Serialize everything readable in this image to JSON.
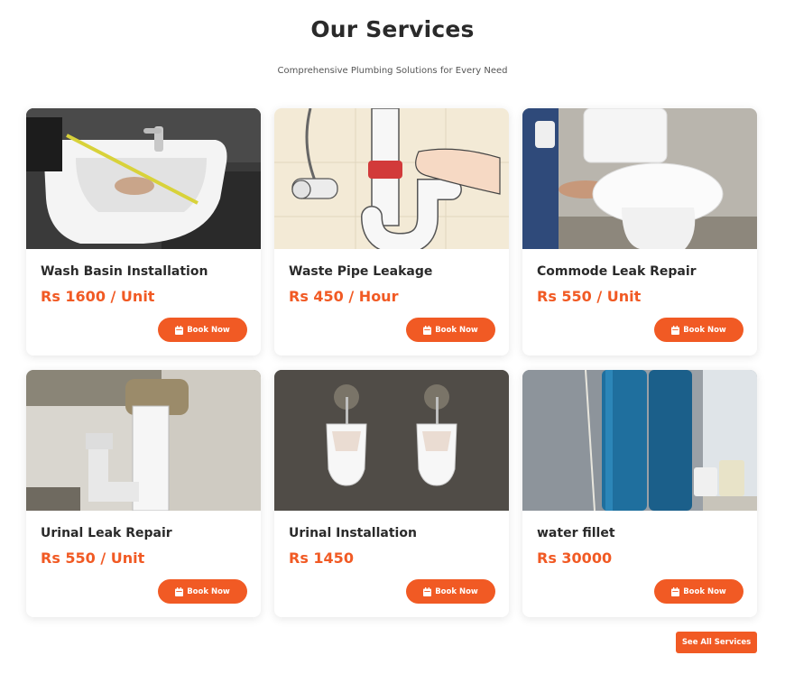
{
  "header": {
    "title": "Our Services",
    "subtitle": "Comprehensive Plumbing Solutions for Every Need"
  },
  "services": [
    {
      "name": "Wash Basin Installation",
      "price": "Rs 1600 / Unit",
      "button": "Book Now"
    },
    {
      "name": "Waste Pipe Leakage",
      "price": "Rs 450 / Hour",
      "button": "Book Now"
    },
    {
      "name": "Commode Leak Repair",
      "price": "Rs 550 / Unit",
      "button": "Book Now"
    },
    {
      "name": "Urinal Leak Repair",
      "price": "Rs 550 / Unit",
      "button": "Book Now"
    },
    {
      "name": "Urinal Installation",
      "price": "Rs 1450",
      "button": "Book Now"
    },
    {
      "name": "water fillet",
      "price": "Rs 30000",
      "button": "Book Now"
    }
  ],
  "footer": {
    "see_all": "See All Services"
  },
  "colors": {
    "accent": "#f15a24",
    "heading": "#2a2a2a"
  },
  "icons": {
    "book_button_icon": "calendar-icon"
  }
}
